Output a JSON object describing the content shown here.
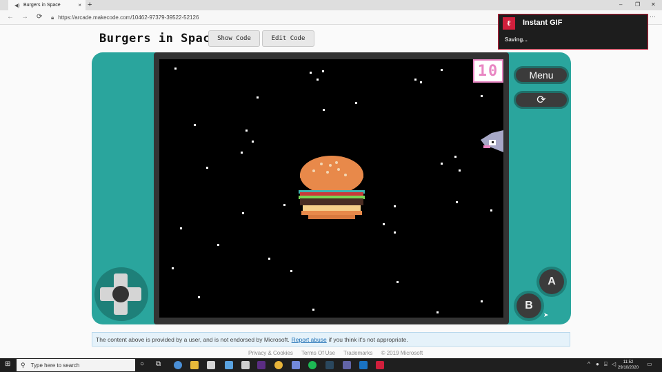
{
  "browser": {
    "tab_title": "Burgers in Space",
    "tab_icon": "speaker-icon",
    "close_glyph": "×",
    "new_tab_glyph": "+",
    "url": "https://arcade.makecode.com/10462-97379-39522-52126",
    "more_glyph": "···",
    "window_controls": [
      "–",
      "❐",
      "✕"
    ]
  },
  "page": {
    "title": "Burgers in Space",
    "buttons": {
      "show_code": "Show Code",
      "edit_code": "Edit Code"
    },
    "score": "10",
    "menu_label": "Menu",
    "reload_glyph": "⟳",
    "a_label": "A",
    "b_label": "B",
    "notice": {
      "text_before": "The content above is provided by a user, and is not endorsed by Microsoft.",
      "link": "Report abuse",
      "text_after": "if you think it's not appropriate."
    },
    "footer": [
      "Privacy & Cookies",
      "Terms Of Use",
      "Trademarks",
      "© 2019 Microsoft"
    ]
  },
  "toast": {
    "logo": "ℓ",
    "title": "Instant GIF",
    "status": "Saving..."
  },
  "taskbar": {
    "search_placeholder": "Type here to search",
    "time": "11:52",
    "date": "29/10/2020",
    "apps": [
      "chrome-icon",
      "file-explorer-icon",
      "store-icon",
      "mail-icon",
      "unity-icon",
      "premiere-icon",
      "chrome-alt-icon",
      "discord-icon",
      "spotify-icon",
      "steam-icon",
      "teams-icon",
      "outlook-icon",
      "instant-gif-icon"
    ]
  },
  "colors": {
    "console": "#2aa59d",
    "console_dark": "#1e8079",
    "score_pink": "#e986c3",
    "toast_accent": "#d01f3c",
    "notice_bg": "#e5f2fa"
  }
}
